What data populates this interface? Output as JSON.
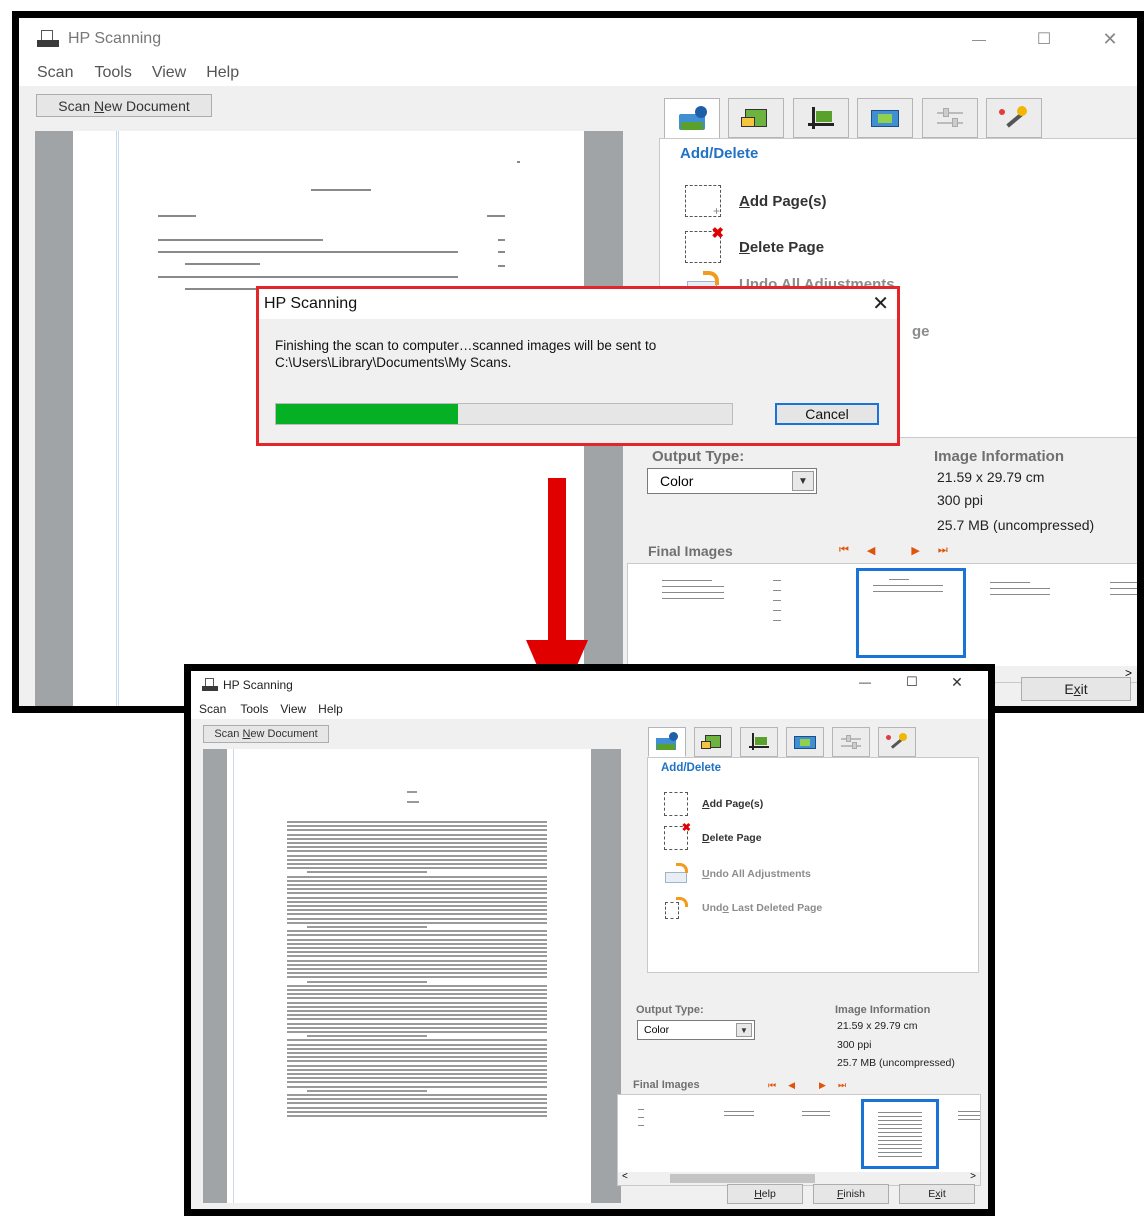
{
  "window": {
    "title": "HP Scanning",
    "controls": {
      "minimize": "—",
      "maximize": "☐",
      "close": "✕"
    }
  },
  "menu": [
    "Scan",
    "Tools",
    "View",
    "Help"
  ],
  "scan_new_document": {
    "pre": "Scan ",
    "underlined": "N",
    "post": "ew Document"
  },
  "tabs": [
    "add-delete",
    "rotate",
    "crop",
    "color-adjust",
    "settings",
    "enhance"
  ],
  "panel": {
    "title": "Add/Delete",
    "actions": {
      "add_pages": {
        "pre": "",
        "u": "A",
        "post": "dd Page(s)"
      },
      "delete_page": {
        "pre": "",
        "u": "D",
        "post": "elete Page"
      },
      "undo_all": {
        "pre": "",
        "u": "U",
        "post": "ndo All Adjustments"
      },
      "undo_last": {
        "pre": "Und",
        "u": "o",
        "post": " Last Deleted Page"
      }
    }
  },
  "top_window_partial": {
    "undo_last_fragment": "ge"
  },
  "output": {
    "label": "Output Type:",
    "value": "Color"
  },
  "image_info": {
    "title": "Image Information",
    "size": "21.59 x 29.79 cm",
    "resolution": "300 ppi",
    "file_size": "25.7 MB (uncompressed)"
  },
  "final_images": {
    "label": "Final Images",
    "nav": [
      "⏮",
      "◀",
      "▶",
      "⏭"
    ]
  },
  "buttons": {
    "help": {
      "pre": "",
      "u": "H",
      "post": "elp"
    },
    "finish": {
      "pre": "",
      "u": "F",
      "post": "inish"
    },
    "exit": {
      "pre": "E",
      "u": "x",
      "post": "it"
    }
  },
  "dialog": {
    "title": "HP Scanning",
    "message_line1": "Finishing the scan to computer…scanned images will be sent to",
    "message_line2": "C:\\Users\\Library\\Documents\\My Scans.",
    "progress_fraction": 0.4,
    "cancel": "Cancel",
    "close": "✕"
  },
  "colors": {
    "accent": "#1f72c5",
    "progress": "#06b025",
    "highlight_red": "#e00000",
    "nav_orange": "#e0530b"
  }
}
